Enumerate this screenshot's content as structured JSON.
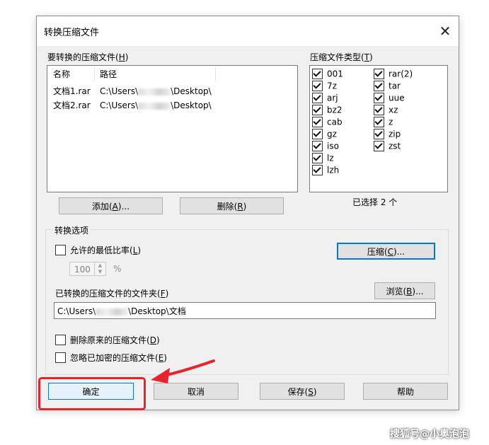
{
  "dialog": {
    "title": "转换压缩文件",
    "close_glyph": "✕"
  },
  "archive_list": {
    "label": "要转换的压缩文件(",
    "hotkey": "H",
    "label_suffix": ")",
    "columns": [
      "名称",
      "路径"
    ],
    "rows": [
      {
        "name": "文档1.rar",
        "path_prefix": "C:\\Users\\",
        "path_suffix": "\\Desktop\\"
      },
      {
        "name": "文档2.rar",
        "path_prefix": "C:\\Users\\",
        "path_suffix": "\\Desktop\\"
      }
    ]
  },
  "archive_types": {
    "label": "压缩文件类型(",
    "hotkey": "T",
    "label_suffix": ")",
    "left_column": [
      {
        "name": "001",
        "checked": true
      },
      {
        "name": "7z",
        "checked": true
      },
      {
        "name": "arj",
        "checked": true
      },
      {
        "name": "bz2",
        "checked": true
      },
      {
        "name": "cab",
        "checked": true
      },
      {
        "name": "gz",
        "checked": true
      },
      {
        "name": "iso",
        "checked": true
      },
      {
        "name": "lz",
        "checked": true
      },
      {
        "name": "lzh",
        "checked": true
      }
    ],
    "right_column": [
      {
        "name": "rar(2)",
        "checked": true
      },
      {
        "name": "tar",
        "checked": true
      },
      {
        "name": "uue",
        "checked": true
      },
      {
        "name": "xz",
        "checked": true
      },
      {
        "name": "z",
        "checked": true
      },
      {
        "name": "zip",
        "checked": true
      },
      {
        "name": "zst",
        "checked": true
      }
    ],
    "selected_count_text": "已选择 2 个"
  },
  "list_buttons": {
    "add": {
      "text": "添加(",
      "hotkey": "A",
      "suffix": ")..."
    },
    "delete": {
      "text": "删除(",
      "hotkey": "R",
      "suffix": ")"
    }
  },
  "options": {
    "group_title": "转换选项",
    "min_ratio": {
      "text": "允许的最低比率(",
      "hotkey": "L",
      "suffix": ")",
      "checked": false
    },
    "ratio_value": "100",
    "ratio_unit": "%",
    "compress_button": {
      "text": "压缩(",
      "hotkey": "C",
      "suffix": ")..."
    },
    "folder_label": {
      "text": "已转换的压缩文件的文件夹(",
      "hotkey": "F",
      "suffix": ")"
    },
    "browse_button": {
      "text": "浏览(",
      "hotkey": "B",
      "suffix": ")..."
    },
    "folder_value_prefix": "C:\\Users\\",
    "folder_value_suffix": "\\Desktop\\文档",
    "delete_original": {
      "text": "删除原来的压缩文件(",
      "hotkey": "D",
      "suffix": ")",
      "checked": false
    },
    "skip_encrypted": {
      "text": "忽略已加密的压缩文件(",
      "hotkey": "E",
      "suffix": ")",
      "checked": false
    }
  },
  "footer_buttons": {
    "ok": {
      "text": "确定"
    },
    "cancel": {
      "text": "取消"
    },
    "save": {
      "text": "保存(",
      "hotkey": "S",
      "suffix": ")"
    },
    "help": {
      "text": "帮助"
    }
  },
  "annotation": {
    "color": "#e8232b"
  },
  "watermark": "搜狐号@小奥泡泡"
}
